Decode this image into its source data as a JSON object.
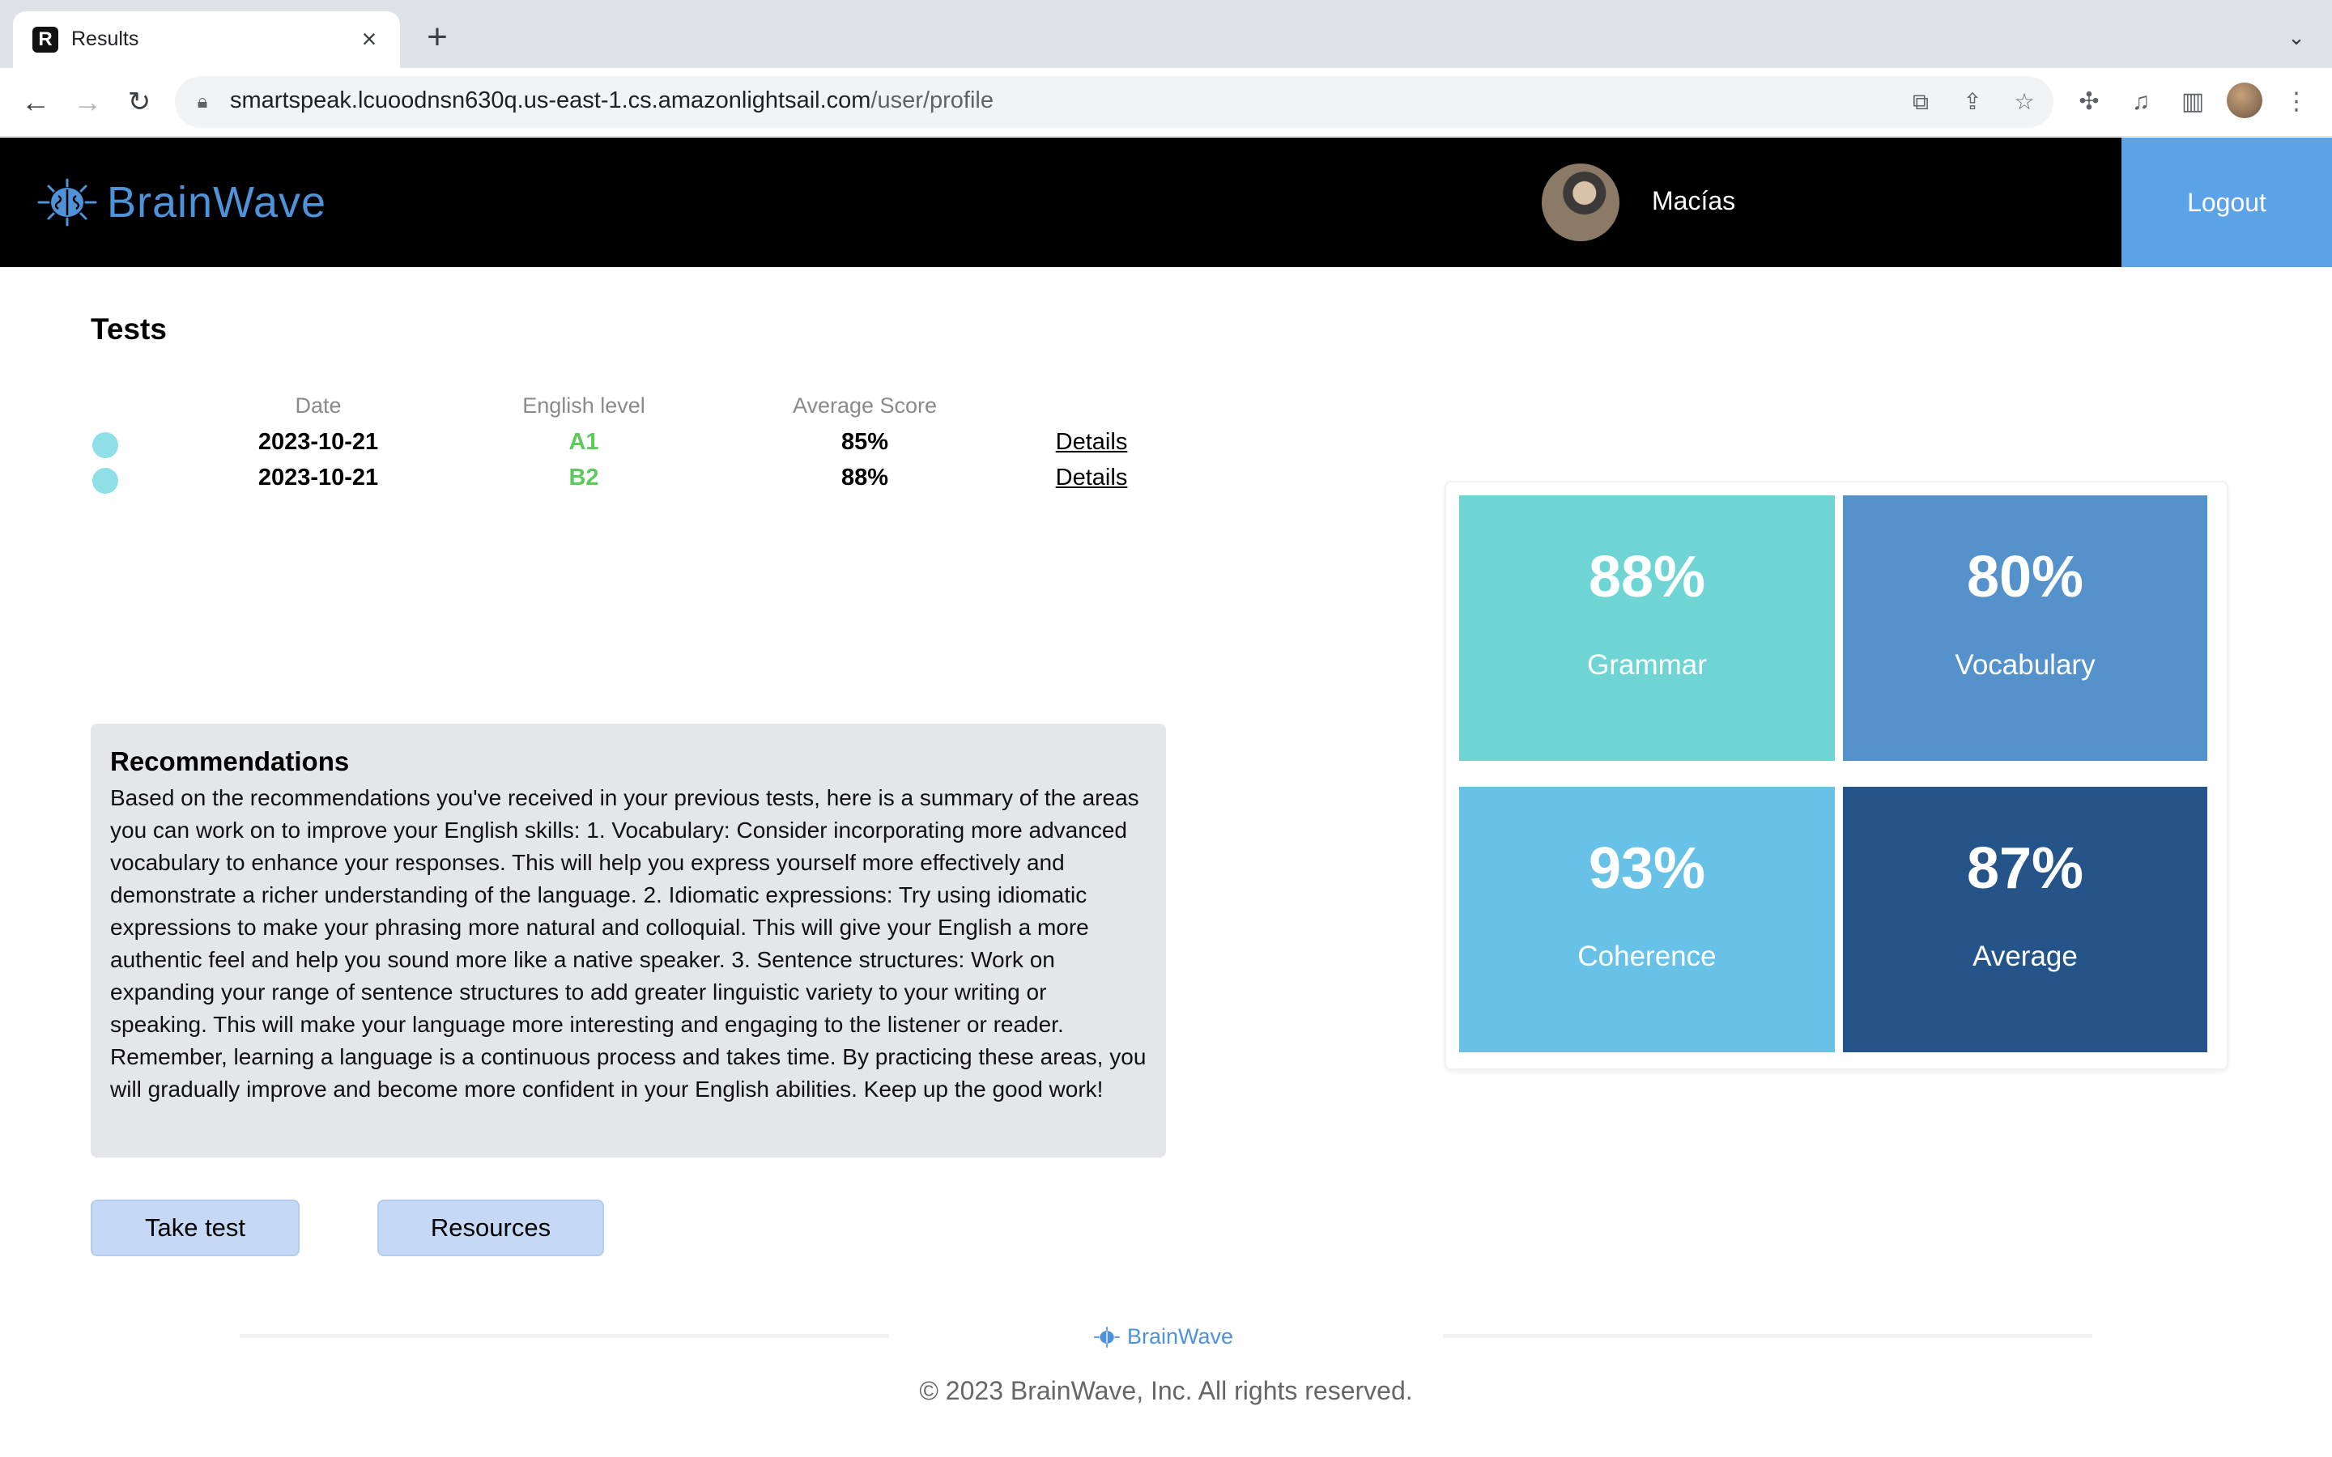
{
  "browser": {
    "tab_title": "Results",
    "url_host": "smartspeak.lcuoodnsn630q.us-east-1.cs.amazonlightsail.com",
    "url_path": "/user/profile"
  },
  "header": {
    "brand": "BrainWave",
    "username": "Macías",
    "logout_label": "Logout"
  },
  "tests": {
    "title": "Tests",
    "columns": [
      "Date",
      "English level",
      "Average Score"
    ],
    "rows": [
      {
        "date": "2023-10-21",
        "level": "A1",
        "score": "85%",
        "link": "Details"
      },
      {
        "date": "2023-10-21",
        "level": "B2",
        "score": "88%",
        "link": "Details"
      }
    ]
  },
  "recommendations": {
    "title": "Recommendations",
    "text": "Based on the recommendations you've received in your previous tests, here is a summary of the areas you can work on to improve your English skills: 1. Vocabulary: Consider incorporating more advanced vocabulary to enhance your responses. This will help you express yourself more effectively and demonstrate a richer understanding of the language. 2. Idiomatic expressions: Try using idiomatic expressions to make your phrasing more natural and colloquial. This will give your English a more authentic feel and help you sound more like a native speaker. 3. Sentence structures: Work on expanding your range of sentence structures to add greater linguistic variety to your writing or speaking. This will make your language more interesting and engaging to the listener or reader. Remember, learning a language is a continuous process and takes time. By practicing these areas, you will gradually improve and become more confident in your English abilities. Keep up the good work!"
  },
  "actions": {
    "take_test": "Take test",
    "resources": "Resources"
  },
  "scores": [
    {
      "value": "88%",
      "label": "Grammar",
      "color": "#6fd4d4"
    },
    {
      "value": "80%",
      "label": "Vocabulary",
      "color": "#5592cb"
    },
    {
      "value": "93%",
      "label": "Coherence",
      "color": "#68c2e8"
    },
    {
      "value": "87%",
      "label": "Average",
      "color": "#25548a"
    }
  ],
  "colors": {
    "header_bg": "#000000",
    "brand": "#4e93d9",
    "logout_bg": "#5ba3e6",
    "level_green": "#5cc95c",
    "button_bg": "#c5d9f6"
  },
  "footer": {
    "brand": "BrainWave",
    "copyright": "© 2023 BrainWave, Inc. All rights reserved."
  }
}
